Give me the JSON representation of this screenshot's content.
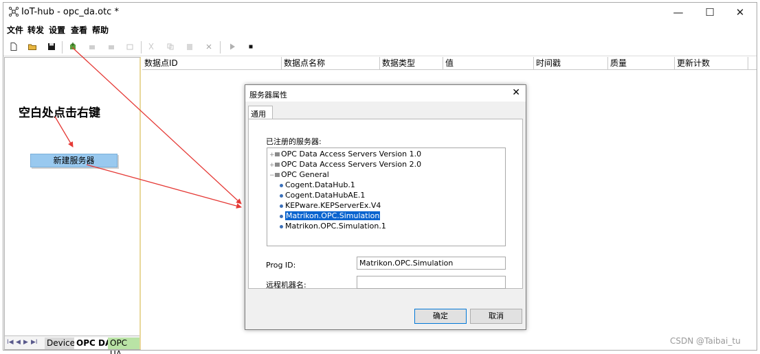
{
  "window": {
    "title": "IoT-hub - opc_da.otc *",
    "minimize": "—",
    "maximize": "☐",
    "close": "✕"
  },
  "menu": [
    "文件",
    "转发",
    "设置",
    "查看",
    "帮助"
  ],
  "left_panel": {
    "annotation": "空白处点击右键",
    "context_item": "新建服务器",
    "nav": [
      "I◀",
      "◀",
      "▶",
      "▶I"
    ],
    "tabs": [
      "Device",
      "OPC DA",
      "OPC UA"
    ]
  },
  "grid": {
    "columns": [
      "数据点ID",
      "数据点名称",
      "数据类型",
      "值",
      "时间戳",
      "质量",
      "更新计数"
    ]
  },
  "dialog": {
    "title": "服务器属性",
    "close": "✕",
    "tab": "通用",
    "registered_label": "已注册的服务器:",
    "tree": [
      {
        "label": "OPC Data Access Servers Version 1.0",
        "level": 0,
        "expander": "+",
        "selected": false
      },
      {
        "label": "OPC Data Access Servers Version 2.0",
        "level": 0,
        "expander": "+",
        "selected": false
      },
      {
        "label": "OPC General",
        "level": 0,
        "expander": "−",
        "selected": false
      },
      {
        "label": "Cogent.DataHub.1",
        "level": 1,
        "expander": "",
        "selected": false
      },
      {
        "label": "Cogent.DataHubAE.1",
        "level": 1,
        "expander": "",
        "selected": false
      },
      {
        "label": "KEPware.KEPServerEx.V4",
        "level": 1,
        "expander": "",
        "selected": false
      },
      {
        "label": "Matrikon.OPC.Simulation",
        "level": 1,
        "expander": "",
        "selected": true
      },
      {
        "label": "Matrikon.OPC.Simulation.1",
        "level": 1,
        "expander": "",
        "selected": false
      }
    ],
    "prog_id_label": "Prog ID:",
    "prog_id_value": "Matrikon.OPC.Simulation",
    "remote_label": "远程机器名:",
    "remote_value": "",
    "ok": "确定",
    "cancel": "取消"
  },
  "watermark": "CSDN @Taibai_tu",
  "colors": {
    "selection": "#0a64cf",
    "context_item_bg": "#99c9ef",
    "annotation_arrow": "#e53935",
    "opc_ua_tab": "#b9e3a5"
  }
}
